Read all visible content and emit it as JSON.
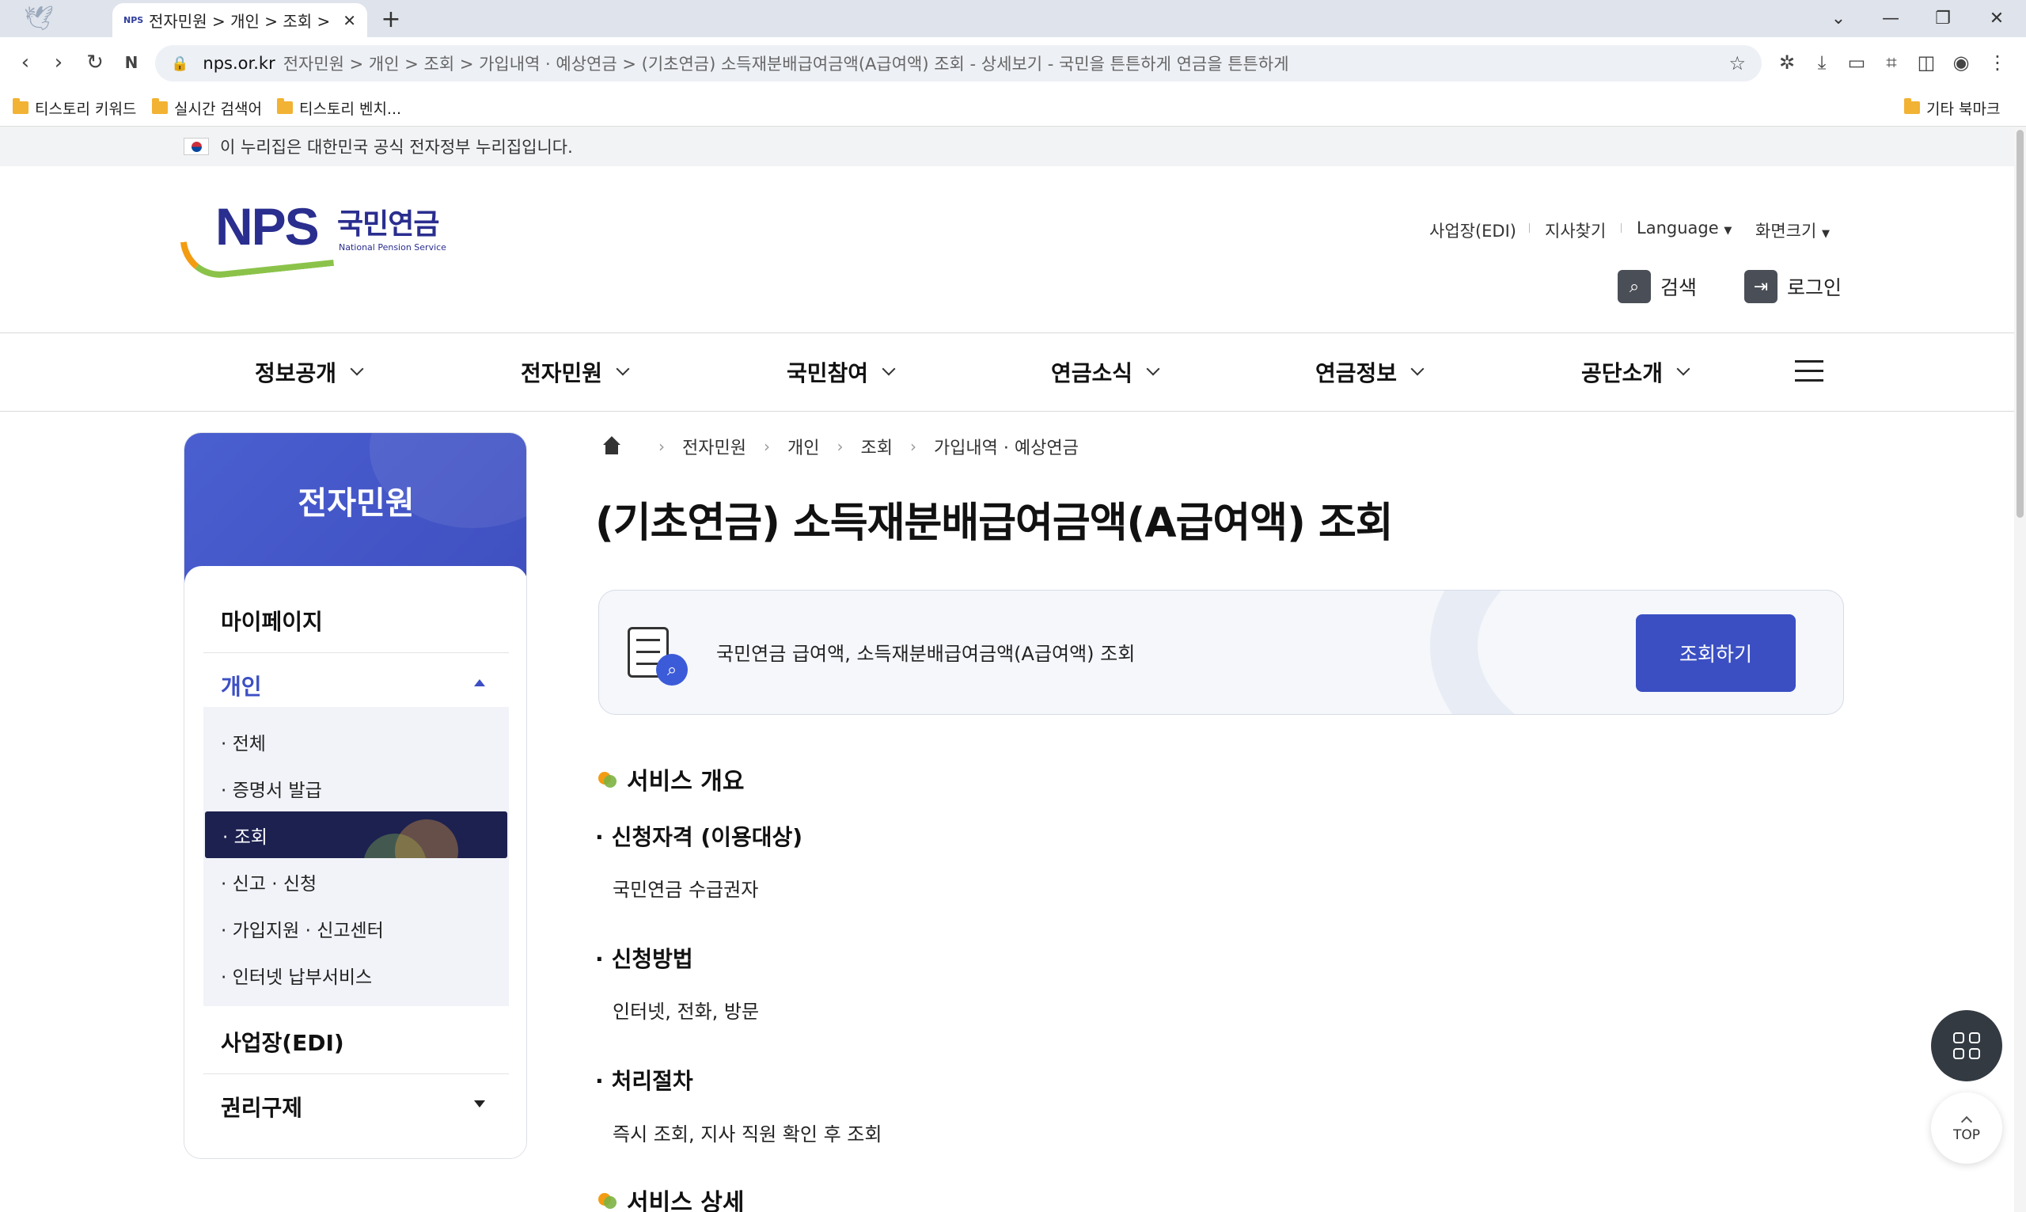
{
  "browser": {
    "tab_title": "전자민원 > 개인 > 조회 > 가입내역 · 예상연금",
    "tab_favicon": "NPS",
    "url_domain": "nps.or.kr",
    "url_path": "전자민원 > 개인 > 조회 > 가입내역 · 예상연금 > (기초연금) 소득재분배급여금액(A급여액) 조회 - 상세보기 - 국민을 튼튼하게 연금을 튼튼하게",
    "bookmarks": [
      "티스토리 키워드",
      "실시간 검색어",
      "티스토리 벤치..."
    ],
    "other_bookmarks": "기타 북마크"
  },
  "gov_banner": "이 누리집은 대한민국 공식 전자정부 누리집입니다.",
  "logo": {
    "mark": "NPS",
    "kr": "국민연금",
    "en": "National Pension Service"
  },
  "util_links": [
    "사업장(EDI)",
    "지사찾기",
    "Language",
    "화면크기"
  ],
  "header_buttons": {
    "search": "검색",
    "login": "로그인"
  },
  "gnb": [
    "정보공개",
    "전자민원",
    "국민참여",
    "연금소식",
    "연금정보",
    "공단소개"
  ],
  "sidebar": {
    "title": "전자민원",
    "menus": [
      {
        "label": "마이페이지"
      },
      {
        "label": "개인"
      },
      {
        "label": "사업장(EDI)"
      },
      {
        "label": "권리구제"
      }
    ],
    "sub_items": [
      {
        "label": "· 전체"
      },
      {
        "label": "· 증명서 발급"
      },
      {
        "label": "· 조회"
      },
      {
        "label": "· 신고 · 신청"
      },
      {
        "label": "· 가입지원 · 신고센터"
      },
      {
        "label": "· 인터넷 납부서비스"
      }
    ]
  },
  "breadcrumb": [
    "전자민원",
    "개인",
    "조회",
    "가입내역 · 예상연금"
  ],
  "page_title": "(기초연금) 소득재분배급여금액(A급여액) 조회",
  "service_box": {
    "text": "국민연금 급여액, 소득재분배급여금액(A급여액) 조회",
    "button": "조회하기"
  },
  "overview": {
    "title": "서비스 개요",
    "items": [
      {
        "title": "신청자격 (이용대상)",
        "text": "국민연금 수급권자"
      },
      {
        "title": "신청방법",
        "text": "인터넷, 전화, 방문"
      },
      {
        "title": "처리절차",
        "text": "즉시 조회, 지사 직원 확인 후 조회"
      }
    ]
  },
  "detail_title": "서비스 상세",
  "fab": {
    "top": "TOP"
  }
}
